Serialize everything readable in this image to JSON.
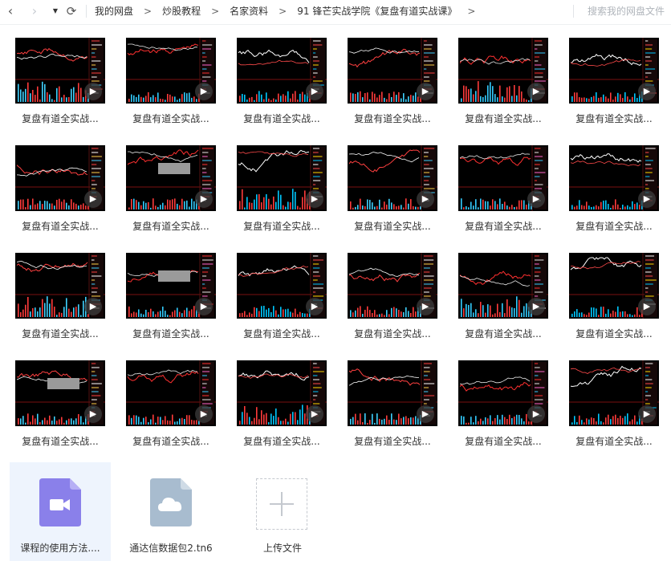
{
  "nav": {
    "back_icon": "‹",
    "forward_icon": "›",
    "dropdown_icon": "▼",
    "refresh_icon": "⟳"
  },
  "breadcrumb": {
    "items": [
      "我的网盘",
      "炒股教程",
      "名家资料",
      "91 锋芒实战学院《复盘有道实战课》"
    ],
    "separator": ">"
  },
  "search": {
    "placeholder": "搜索我的网盘文件"
  },
  "videos": [
    {
      "label": "复盘有道全实战..."
    },
    {
      "label": "复盘有道全实战..."
    },
    {
      "label": "复盘有道全实战..."
    },
    {
      "label": "复盘有道全实战..."
    },
    {
      "label": "复盘有道全实战..."
    },
    {
      "label": "复盘有道全实战..."
    },
    {
      "label": "复盘有道全实战..."
    },
    {
      "label": "复盘有道全实战..."
    },
    {
      "label": "复盘有道全实战..."
    },
    {
      "label": "复盘有道全实战..."
    },
    {
      "label": "复盘有道全实战..."
    },
    {
      "label": "复盘有道全实战..."
    },
    {
      "label": "复盘有道全实战..."
    },
    {
      "label": "复盘有道全实战..."
    },
    {
      "label": "复盘有道全实战..."
    },
    {
      "label": "复盘有道全实战..."
    },
    {
      "label": "复盘有道全实战..."
    },
    {
      "label": "复盘有道全实战..."
    },
    {
      "label": "复盘有道全实战..."
    },
    {
      "label": "复盘有道全实战..."
    },
    {
      "label": "复盘有道全实战..."
    },
    {
      "label": "复盘有道全实战..."
    },
    {
      "label": "复盘有道全实战..."
    },
    {
      "label": "复盘有道全实战..."
    }
  ],
  "files": [
    {
      "label": "课程的使用方法....",
      "icon": "video-file-icon",
      "selected": true
    },
    {
      "label": "通达信数据包2.tn6",
      "icon": "cloud-file-icon",
      "selected": false
    },
    {
      "label": "上传文件",
      "icon": "plus-icon",
      "selected": false
    }
  ],
  "colors": {
    "video_icon": "#8a80ea",
    "cloud_icon": "#a8bccf",
    "selected_bg": "#eef4fd"
  }
}
